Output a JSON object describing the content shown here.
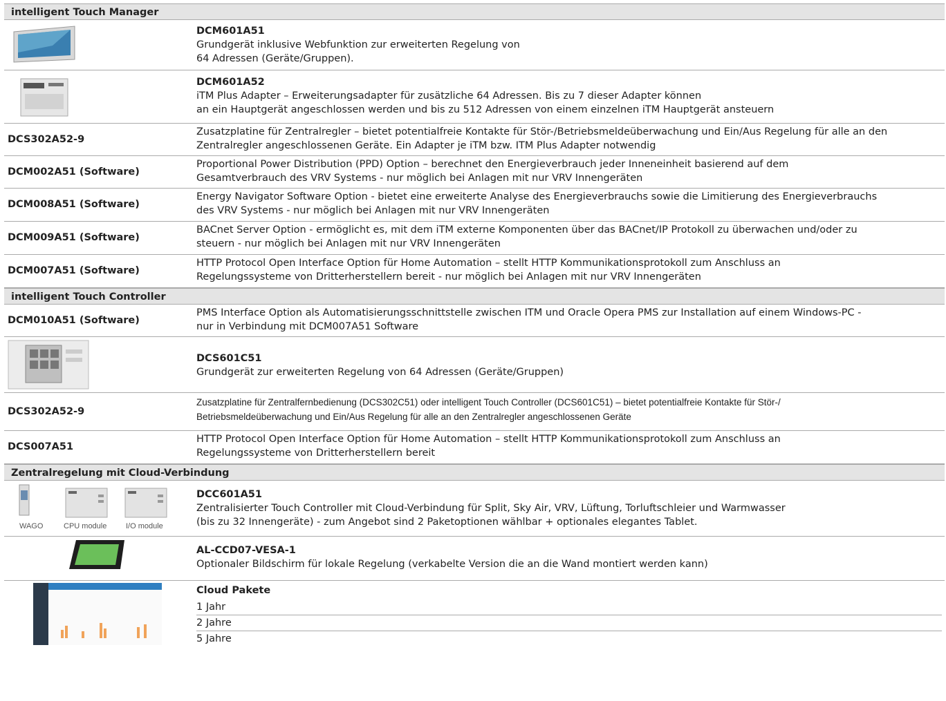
{
  "sections": {
    "s1": "intelligent Touch Manager",
    "s2": "intelligent Touch Controller",
    "s3": "Zentralregelung mit Cloud-Verbindung"
  },
  "r1": {
    "title": "DCM601A51",
    "line1": "Grundgerät inklusive Webfunktion zur erweiterten Regelung von",
    "line2": "64 Adressen (Geräte/Gruppen)."
  },
  "r2": {
    "title": "DCM601A52",
    "line1": "iTM Plus Adapter – Erweiterungsadapter für zusätzliche 64 Adressen. Bis zu 7 dieser Adapter können",
    "line2": "an ein Hauptgerät angeschlossen werden und bis zu 512 Adressen von einem einzelnen iTM Hauptgerät ansteuern"
  },
  "r3": {
    "code": "DCS302A52-9",
    "line1": "Zusatzplatine für Zentralregler – bietet potentialfreie Kontakte für Stör-/Betriebsmeldeüberwachung und Ein/Aus Regelung für alle an den",
    "line2": "Zentralregler angeschlossenen Geräte. Ein Adapter je iTM bzw. ITM Plus Adapter notwendig"
  },
  "r4": {
    "code": "DCM002A51 (Software)",
    "line1": "Proportional Power Distribution (PPD) Option – berechnet den Energieverbrauch jeder Inneneinheit basierend auf dem",
    "line2": "Gesamtverbrauch des VRV Systems - nur möglich bei Anlagen mit nur VRV Innengeräten"
  },
  "r5": {
    "code": "DCM008A51 (Software)",
    "line1": "Energy Navigator Software Option - bietet eine erweiterte Analyse des Energieverbrauchs sowie die Limitierung des Energieverbrauchs",
    "line2": "des VRV Systems - nur möglich bei Anlagen mit nur VRV Innengeräten"
  },
  "r6": {
    "code": "DCM009A51 (Software)",
    "line1": "BACnet Server Option - ermöglicht es, mit dem iTM externe Komponenten über das BACnet/IP Protokoll zu überwachen und/oder zu",
    "line2": "steuern - nur möglich bei Anlagen mit nur VRV Innengeräten"
  },
  "r7": {
    "code": "DCM007A51 (Software)",
    "line1": "HTTP Protocol Open Interface Option für Home Automation – stellt HTTP Kommunikationsprotokoll zum Anschluss an",
    "line2": "Regelungssysteme von Dritterherstellern bereit - nur möglich bei Anlagen mit nur VRV Innengeräten"
  },
  "r8": {
    "code": "DCM010A51 (Software)",
    "line1": "PMS Interface Option als Automatisierungsschnittstelle zwischen ITM und Oracle Opera PMS zur Installation auf einem Windows-PC -",
    "line2": "nur in Verbindung mit DCM007A51 Software"
  },
  "r9": {
    "title": "DCS601C51",
    "line1": "Grundgerät zur erweiterten Regelung von 64 Adressen (Geräte/Gruppen)"
  },
  "r10": {
    "code": "DCS302A52-9",
    "line1": "Zusatzplatine für Zentralfernbedienung (DCS302C51) oder intelligent Touch Controller (DCS601C51) – bietet potentialfreie Kontakte für Stör-/",
    "line2": "Betriebsmeldeüberwachung und Ein/Aus Regelung für alle an den Zentralregler angeschlossenen Geräte"
  },
  "r11": {
    "code": "DCS007A51",
    "line1": "HTTP Protocol Open Interface Option für Home Automation – stellt HTTP Kommunikationsprotokoll zum Anschluss an",
    "line2": "Regelungssysteme von Dritterherstellern bereit"
  },
  "r12": {
    "title": "DCC601A51",
    "line1": "Zentralisierter Touch Controller mit Cloud-Verbindung für Split, Sky Air, VRV, Lüftung, Torluftschleier und Warmwasser",
    "line2": "(bis zu 32 Innengeräte) - zum Angebot sind 2 Paketoptionen wählbar + optionales elegantes Tablet.",
    "cap1": "WAGO",
    "cap2": "CPU module",
    "cap3": "I/O module"
  },
  "r13": {
    "title": "AL-CCD07-VESA-1",
    "line1": "Optionaler Bildschirm für lokale Regelung (verkabelte Version die an die Wand montiert werden kann)"
  },
  "r14": {
    "title": "Cloud Pakete",
    "p1": "1 Jahr",
    "p2": "2 Jahre",
    "p3": "5 Jahre"
  }
}
